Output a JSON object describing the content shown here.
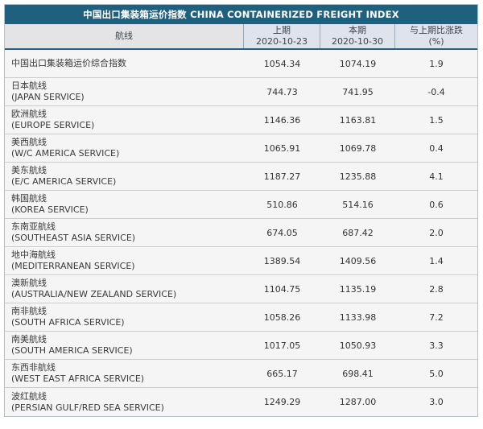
{
  "page": {
    "title": "中国出口集装箱运价指数 CHINA CONTAINERIZED FREIGHT INDEX"
  },
  "table": {
    "columns": {
      "route": "航线",
      "prev_label": "上期",
      "prev_date": "2020-10-23",
      "curr_label": "本期",
      "curr_date": "2020-10-30",
      "change_label": "与上期比涨跌",
      "change_unit": "(%)"
    },
    "rows": [
      {
        "name_cn": "中国出口集装箱运价综合指数",
        "name_en": "",
        "prev": "1054.34",
        "curr": "1074.19",
        "change": "1.9"
      },
      {
        "name_cn": "日本航线",
        "name_en": "(JAPAN SERVICE)",
        "prev": "744.73",
        "curr": "741.95",
        "change": "-0.4"
      },
      {
        "name_cn": "欧洲航线",
        "name_en": "(EUROPE SERVICE)",
        "prev": "1146.36",
        "curr": "1163.81",
        "change": "1.5"
      },
      {
        "name_cn": "美西航线",
        "name_en": "(W/C AMERICA SERVICE)",
        "prev": "1065.91",
        "curr": "1069.78",
        "change": "0.4"
      },
      {
        "name_cn": "美东航线",
        "name_en": "(E/C AMERICA SERVICE)",
        "prev": "1187.27",
        "curr": "1235.88",
        "change": "4.1"
      },
      {
        "name_cn": "韩国航线",
        "name_en": "(KOREA SERVICE)",
        "prev": "510.86",
        "curr": "514.16",
        "change": "0.6"
      },
      {
        "name_cn": "东南亚航线",
        "name_en": "(SOUTHEAST ASIA SERVICE)",
        "prev": "674.05",
        "curr": "687.42",
        "change": "2.0"
      },
      {
        "name_cn": "地中海航线",
        "name_en": "(MEDITERRANEAN SERVICE)",
        "prev": "1389.54",
        "curr": "1409.56",
        "change": "1.4"
      },
      {
        "name_cn": "澳新航线",
        "name_en": "(AUSTRALIA/NEW ZEALAND SERVICE)",
        "prev": "1104.75",
        "curr": "1135.19",
        "change": "2.8"
      },
      {
        "name_cn": "南非航线",
        "name_en": "(SOUTH AFRICA SERVICE)",
        "prev": "1058.26",
        "curr": "1133.98",
        "change": "7.2"
      },
      {
        "name_cn": "南美航线",
        "name_en": "(SOUTH AMERICA SERVICE)",
        "prev": "1017.05",
        "curr": "1050.93",
        "change": "3.3"
      },
      {
        "name_cn": "东西非航线",
        "name_en": "(WEST EAST AFRICA SERVICE)",
        "prev": "665.17",
        "curr": "698.41",
        "change": "5.0"
      },
      {
        "name_cn": "波红航线",
        "name_en": "(PERSIAN GULF/RED SEA SERVICE)",
        "prev": "1249.29",
        "curr": "1287.00",
        "change": "3.0"
      }
    ]
  },
  "colors": {
    "title_bar": "#20607f",
    "header_route_bg": "#e4e4e6",
    "header_value_bg": "#dfe3ec",
    "header_divider": "#97a9b6",
    "header_underline": "#26607f",
    "row_bg": "#f5f5f6",
    "row_divider": "#cccccc",
    "outer_border": "#adc3d2",
    "title_text": "#ffffff",
    "body_text": "#3a3a3a"
  },
  "chart_data": {
    "type": "table",
    "title": "中国出口集装箱运价指数 CHINA CONTAINERIZED FREIGHT INDEX",
    "columns": [
      "航线",
      "上期 2020-10-23",
      "本期 2020-10-30",
      "与上期比涨跌 (%)"
    ],
    "rows": [
      [
        "中国出口集装箱运价综合指数",
        1054.34,
        1074.19,
        1.9
      ],
      [
        "日本航线 (JAPAN SERVICE)",
        744.73,
        741.95,
        -0.4
      ],
      [
        "欧洲航线 (EUROPE SERVICE)",
        1146.36,
        1163.81,
        1.5
      ],
      [
        "美西航线 (W/C AMERICA SERVICE)",
        1065.91,
        1069.78,
        0.4
      ],
      [
        "美东航线 (E/C AMERICA SERVICE)",
        1187.27,
        1235.88,
        4.1
      ],
      [
        "韩国航线 (KOREA SERVICE)",
        510.86,
        514.16,
        0.6
      ],
      [
        "东南亚航线 (SOUTHEAST ASIA SERVICE)",
        674.05,
        687.42,
        2.0
      ],
      [
        "地中海航线 (MEDITERRANEAN SERVICE)",
        1389.54,
        1409.56,
        1.4
      ],
      [
        "澳新航线 (AUSTRALIA/NEW ZEALAND SERVICE)",
        1104.75,
        1135.19,
        2.8
      ],
      [
        "南非航线 (SOUTH AFRICA SERVICE)",
        1058.26,
        1133.98,
        7.2
      ],
      [
        "南美航线 (SOUTH AMERICA SERVICE)",
        1017.05,
        1050.93,
        3.3
      ],
      [
        "东西非航线 (WEST EAST AFRICA SERVICE)",
        665.17,
        698.41,
        5.0
      ],
      [
        "波红航线 (PERSIAN GULF/RED SEA SERVICE)",
        1249.29,
        1287.0,
        3.0
      ]
    ]
  }
}
